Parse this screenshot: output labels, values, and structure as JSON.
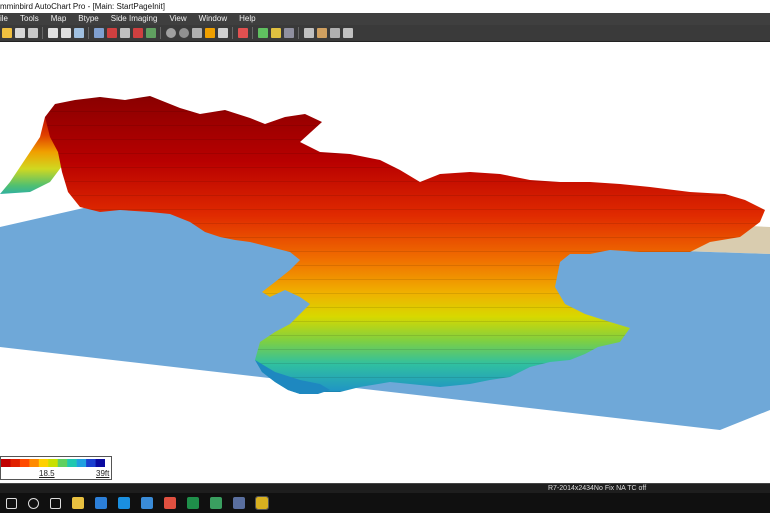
{
  "window": {
    "title": "mminbird AutoChart Pro - [Main: StartPageInit]"
  },
  "menu": [
    {
      "label": "ile"
    },
    {
      "label": "Tools"
    },
    {
      "label": "Map"
    },
    {
      "label": "Btype"
    },
    {
      "label": "Side Imaging"
    },
    {
      "label": "View"
    },
    {
      "label": "Window"
    },
    {
      "label": "Help"
    }
  ],
  "toolbar": {
    "icons": [
      "folder-open-icon",
      "save-icon",
      "print-icon",
      "zoom-in-icon",
      "zoom-out-icon",
      "select-icon",
      "chart-icon",
      "waypoint-icon",
      "ruler-icon",
      "route-icon",
      "track-icon",
      "circle-icon",
      "sphere-icon",
      "square-icon",
      "contour-icon",
      "copy-icon",
      "palette-icon",
      "depth-icon",
      "export-icon",
      "grid-icon",
      "layers-icon",
      "settings-icon",
      "measure-icon",
      "pencil-icon"
    ]
  },
  "legend": {
    "min_label": "18.5",
    "max_label": "39ft",
    "colors": [
      "#c00000",
      "#e02000",
      "#ff4a00",
      "#ff8a00",
      "#ffd000",
      "#c8e000",
      "#60d060",
      "#20c8b0",
      "#20a0e0",
      "#1a40d0",
      "#0a0aa0"
    ]
  },
  "status": {
    "text": "R7-2014x2434No Fix    NA TC off"
  },
  "map": {
    "water_color": "#6fa8d8",
    "land_color": "#d8ccb0"
  },
  "taskbar": {
    "icons": [
      "windows-search-icon",
      "cortana-icon",
      "task-view-icon",
      "file-explorer-icon",
      "mail-icon",
      "edge-icon",
      "media-player-icon",
      "chrome-icon",
      "excel-icon",
      "app-icon",
      "app-icon",
      "autochart-icon"
    ]
  }
}
